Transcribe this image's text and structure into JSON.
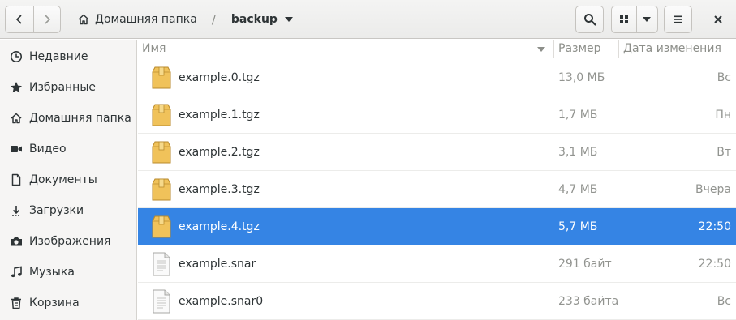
{
  "header": {
    "back_icon": "chevron-left-icon",
    "forward_icon": "chevron-right-icon",
    "home_crumb": "Домашняя папка",
    "separator": "/",
    "current_folder": "backup",
    "search_icon": "search-icon",
    "view_icon": "grid-view-icon",
    "view_dropdown_icon": "chevron-down-icon",
    "menu_icon": "hamburger-menu-icon",
    "close_icon": "close-icon"
  },
  "sidebar": {
    "items": [
      {
        "label": "Недавние",
        "icon": "clock-icon"
      },
      {
        "label": "Избранные",
        "icon": "star-icon"
      },
      {
        "label": "Домашняя папка",
        "icon": "home-icon"
      },
      {
        "label": "Видео",
        "icon": "video-icon"
      },
      {
        "label": "Документы",
        "icon": "document-icon"
      },
      {
        "label": "Загрузки",
        "icon": "download-icon"
      },
      {
        "label": "Изображения",
        "icon": "camera-icon"
      },
      {
        "label": "Музыка",
        "icon": "music-icon"
      },
      {
        "label": "Корзина",
        "icon": "trash-icon"
      }
    ]
  },
  "columns": {
    "name": "Имя",
    "size": "Размер",
    "date": "Дата изменения"
  },
  "files": [
    {
      "name": "example.0.tgz",
      "size": "13,0 МБ",
      "date": "Вс",
      "type": "archive",
      "selected": false
    },
    {
      "name": "example.1.tgz",
      "size": "1,7 МБ",
      "date": "Пн",
      "type": "archive",
      "selected": false
    },
    {
      "name": "example.2.tgz",
      "size": "3,1 МБ",
      "date": "Вт",
      "type": "archive",
      "selected": false
    },
    {
      "name": "example.3.tgz",
      "size": "4,7 МБ",
      "date": "Вчера",
      "type": "archive",
      "selected": false
    },
    {
      "name": "example.4.tgz",
      "size": "5,7 МБ",
      "date": "22:50",
      "type": "archive",
      "selected": true
    },
    {
      "name": "example.snar",
      "size": "291 байт",
      "date": "22:50",
      "type": "text",
      "selected": false
    },
    {
      "name": "example.snar0",
      "size": "233 байта",
      "date": "Вс",
      "type": "text",
      "selected": false
    }
  ],
  "colors": {
    "selection": "#3584e4",
    "archive_icon": "#f0c25a"
  }
}
